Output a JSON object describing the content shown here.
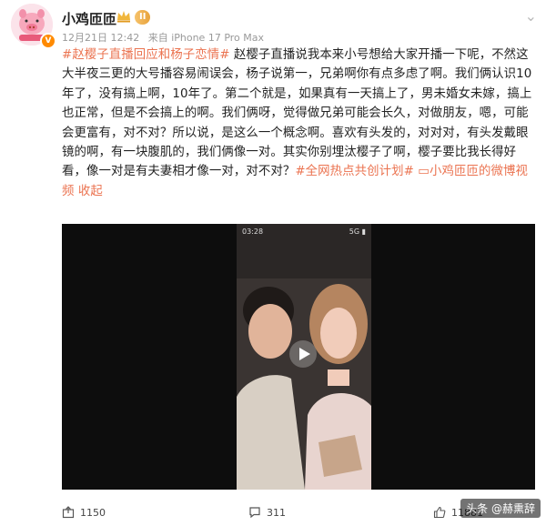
{
  "user": {
    "name": "小鸡匝匝",
    "level": "II",
    "avatar_badge": "V",
    "date": "12月21日 12:42",
    "source": "来自 iPhone 17 Pro Max"
  },
  "post": {
    "tag1": "#赵樱子直播回应和杨子恋情#",
    "body": " 赵樱子直播说我本来小号想给大家开播一下呢，不然这大半夜三更的大号播容易闹误会，杨子说第一，兄弟啊你有点多虑了啊。我们俩认识10年了，没有搞上啊，10年了。第二个就是，如果真有一天搞上了，男未婚女未嫁，搞上也正常，但是不会搞上的啊。我们俩呀，觉得做兄弟可能会长久，对做朋友，嗯，可能会更富有，对不对？所以说，是这么一个概念啊。喜欢有头发的，对对对，有头发戴眼镜的啊，有一块腹肌的，我们俩像一对。其实你别埋汰樱子了啊，樱子要比我长得好看，像一对是有夫妻相才像一对，对不对？",
    "tag2": "#全网热点共创计划#",
    "video_link": "小鸡匝匝的微博视频",
    "collapse": "收起"
  },
  "video": {
    "status_time": "03:28",
    "status_right": "5G ▮"
  },
  "actions": {
    "share_count": "1150",
    "comment_count": "311",
    "like_count": "11881"
  },
  "watermark": "头条 @赫熏辞",
  "colors": {
    "accent": "#eb7350",
    "meta": "#999999"
  }
}
